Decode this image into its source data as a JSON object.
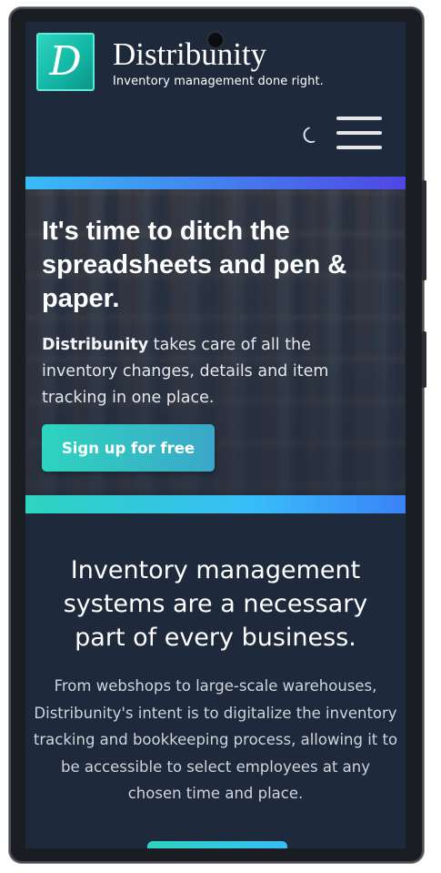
{
  "header": {
    "logo_letter": "D",
    "brand_name": "Distribunity",
    "tagline": "Inventory management done right.",
    "theme_toggle_icon": "moon-icon",
    "menu_icon": "hamburger-menu-icon"
  },
  "hero": {
    "title": "It's time to ditch the spreadsheets and pen & paper.",
    "text_strong": "Distribunity",
    "text_rest": " takes care of all the inventory changes, details and item tracking in one place.",
    "cta_label": "Sign up for free"
  },
  "info": {
    "title": "Inventory management systems are a necessary part of every business.",
    "text": "From webshops to large-scale warehouses, Distribunity's intent is to digitalize the inventory tracking and bookkeeping process, allowing it to be accessible to select employees at any chosen time and place."
  },
  "colors": {
    "background": "#1e293b",
    "accent_teal": "#2dd4bf",
    "accent_blue": "#3b82f6"
  }
}
